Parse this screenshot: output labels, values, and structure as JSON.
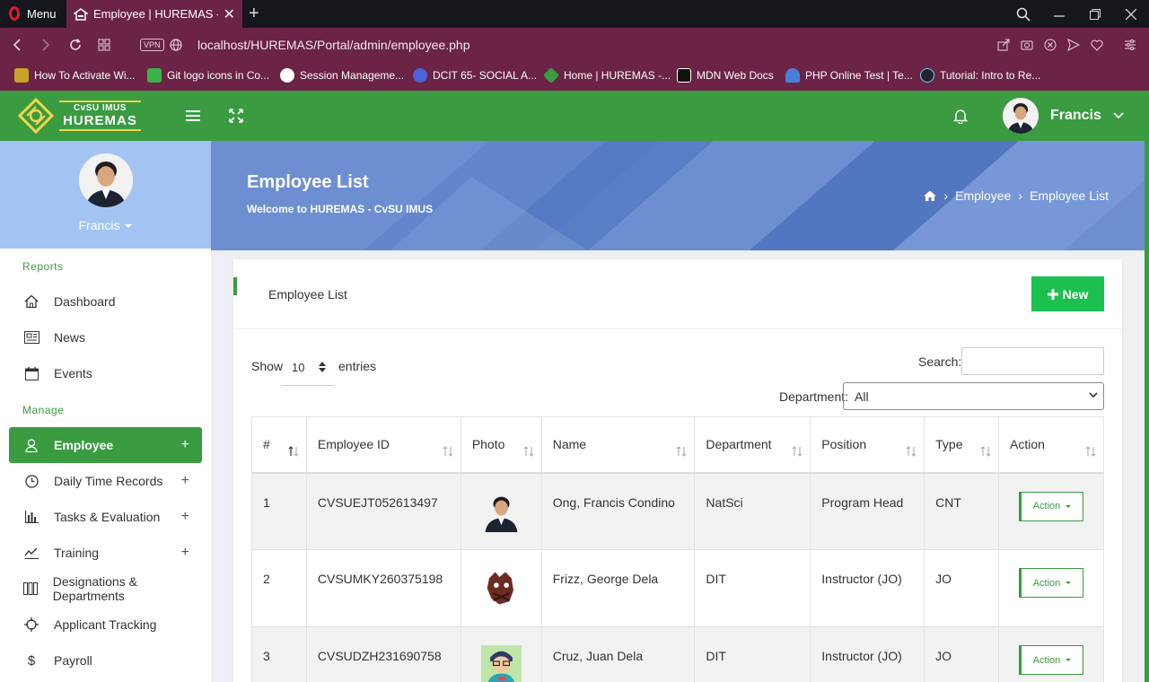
{
  "browser": {
    "menu_label": "Menu",
    "tab_title": "Employee | HUREMAS - CvSU",
    "vpn_label": "VPN",
    "url": "localhost/HUREMAS/Portal/admin/employee.php",
    "bookmarks": [
      {
        "label": "How To Activate Wi...",
        "color": "#c9a227"
      },
      {
        "label": "Git logo icons in Co...",
        "color": "#3bb34a"
      },
      {
        "label": "Session Manageme...",
        "color": "#ffffff"
      },
      {
        "label": "DCIT 65- SOCIAL A...",
        "color": "#4a63d8"
      },
      {
        "label": "Home | HUREMAS -...",
        "color": "#3a9b41"
      },
      {
        "label": "MDN Web Docs",
        "color": "#ffffff"
      },
      {
        "label": "PHP Online Test | Te...",
        "color": "#4a7fd8"
      },
      {
        "label": "Tutorial: Intro to Re...",
        "color": "#61dafb"
      }
    ]
  },
  "header": {
    "logo_small": "CvSU IMUS",
    "logo_big": "HUREMAS",
    "user_name": "Francis",
    "accent": "#3a9b41"
  },
  "sidebar": {
    "profile_name": "Francis",
    "sections": {
      "reports": "Reports",
      "manage": "Manage"
    },
    "items": [
      {
        "label": "Dashboard",
        "icon": "home-icon"
      },
      {
        "label": "News",
        "icon": "newspaper-icon"
      },
      {
        "label": "Events",
        "icon": "calendar-icon"
      },
      {
        "label": "Employee",
        "icon": "user-icon",
        "active": true
      },
      {
        "label": "Daily Time Records",
        "icon": "clock-icon"
      },
      {
        "label": "Tasks & Evaluation",
        "icon": "bar-chart-icon"
      },
      {
        "label": "Training",
        "icon": "line-chart-icon"
      },
      {
        "label": "Designations & Departments",
        "icon": "columns-icon"
      },
      {
        "label": "Applicant Tracking",
        "icon": "crosshair-icon"
      },
      {
        "label": "Payroll",
        "icon": "dollar-icon"
      }
    ],
    "expand_symbol": "+"
  },
  "banner": {
    "title": "Employee List",
    "subtitle": "Welcome to HUREMAS - CvSU IMUS",
    "breadcrumbs": [
      "Employee",
      "Employee List"
    ],
    "separator": "›"
  },
  "card": {
    "title": "Employee List",
    "new_button": "New"
  },
  "table_controls": {
    "show_label": "Show",
    "entries_value": "10",
    "entries_label": "entries",
    "search_label": "Search:",
    "search_value": "",
    "department_label": "Department:",
    "department_value": "All"
  },
  "table": {
    "columns": [
      "#",
      "Employee ID",
      "Photo",
      "Name",
      "Department",
      "Position",
      "Type",
      "Action"
    ],
    "rows": [
      {
        "num": "1",
        "id": "CVSUEJT052613497",
        "name": "Ong, Francis Condino",
        "department": "NatSci",
        "position": "Program Head",
        "type": "CNT",
        "action": "Action"
      },
      {
        "num": "2",
        "id": "CVSUMKY260375198",
        "name": "Frizz, George Dela",
        "department": "DIT",
        "position": "Instructor (JO)",
        "type": "JO",
        "action": "Action"
      },
      {
        "num": "3",
        "id": "CVSUDZH231690758",
        "name": "Cruz, Juan Dela",
        "department": "DIT",
        "position": "Instructor (JO)",
        "type": "JO",
        "action": "Action"
      }
    ]
  }
}
